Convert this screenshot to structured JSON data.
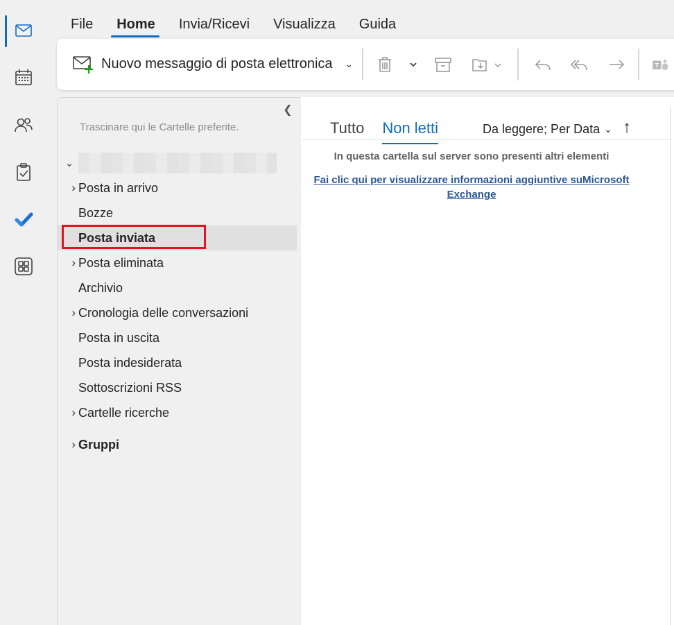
{
  "rail": {
    "items": [
      "mail",
      "calendar",
      "people",
      "tasks",
      "to-do",
      "apps"
    ]
  },
  "menu": {
    "items": [
      "File",
      "Home",
      "Invia/Ricevi",
      "Visualizza",
      "Guida"
    ],
    "active": "Home"
  },
  "ribbon": {
    "new_message_label": "Nuovo messaggio di posta elettronica"
  },
  "folder_pane": {
    "favorites_hint": "Trascinare qui le Cartelle preferite.",
    "folders": [
      {
        "name": "Posta in arrivo",
        "expandable": true
      },
      {
        "name": "Bozze",
        "expandable": false
      },
      {
        "name": "Posta inviata",
        "expandable": false,
        "selected": true
      },
      {
        "name": "Posta eliminata",
        "expandable": true
      },
      {
        "name": "Archivio",
        "expandable": false
      },
      {
        "name": "Cronologia delle conversazioni",
        "expandable": true
      },
      {
        "name": "Posta in uscita",
        "expandable": false
      },
      {
        "name": "Posta indesiderata",
        "expandable": false
      },
      {
        "name": "Sottoscrizioni RSS",
        "expandable": false
      },
      {
        "name": "Cartelle ricerche",
        "expandable": true
      }
    ],
    "groups_label": "Gruppi"
  },
  "message_list": {
    "tabs": [
      "Tutto",
      "Non letti"
    ],
    "active_tab": "Non letti",
    "sort_label": "Da leggere; Per Data",
    "server_info": "In questa cartella sul server sono presenti altri elementi",
    "link_text": "Fai clic qui per visualizzare informazioni aggiuntive suMicrosoft Exchange"
  },
  "colors": {
    "accent": "#0f6cbd",
    "highlight": "#e3121e",
    "link": "#2b5797"
  }
}
